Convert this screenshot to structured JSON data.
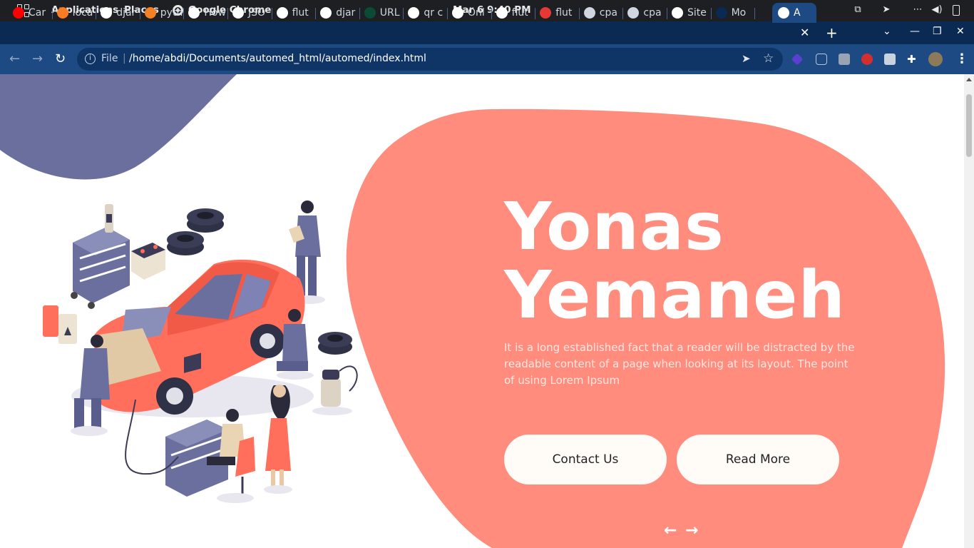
{
  "topbar": {
    "applications": "Applications",
    "places": "Places",
    "app_name": "Google Chrome",
    "clock": "Mar 6   9:40 PM"
  },
  "tabs": [
    {
      "label": "Car",
      "icon": "youtube-icon",
      "color": "#ff0000"
    },
    {
      "label": "loca",
      "icon": "xampp-icon",
      "color": "#fb7a24"
    },
    {
      "label": "djar",
      "icon": "google-icon",
      "color": "#ffffff"
    },
    {
      "label": "pyth",
      "icon": "stackoverflow-icon",
      "color": "#f48024"
    },
    {
      "label": "How",
      "icon": "globe-icon",
      "color": "#ffffff"
    },
    {
      "label": "JSO",
      "icon": "globe-icon",
      "color": "#ffffff"
    },
    {
      "label": "flut",
      "icon": "google-icon",
      "color": "#ffffff"
    },
    {
      "label": "djar",
      "icon": "google-icon",
      "color": "#ffffff"
    },
    {
      "label": "URL",
      "icon": "django-icon",
      "color": "#0c4b33"
    },
    {
      "label": "qr c",
      "icon": "google-icon",
      "color": "#ffffff"
    },
    {
      "label": "Onl",
      "icon": "qr-icon",
      "color": "#ffffff"
    },
    {
      "label": "flut",
      "icon": "google-icon",
      "color": "#ffffff"
    },
    {
      "label": "flut",
      "icon": "red-icon",
      "color": "#e53935"
    },
    {
      "label": "cpa",
      "icon": "link-icon",
      "color": "#cfd6e0"
    },
    {
      "label": "cpa",
      "icon": "link-icon",
      "color": "#cfd6e0"
    },
    {
      "label": "Site",
      "icon": "globe-icon",
      "color": "#ffffff"
    },
    {
      "label": "Mo",
      "icon": "blank-icon",
      "color": "#0b2a53"
    },
    {
      "label": "A",
      "icon": "globe-icon",
      "color": "#ffffff"
    }
  ],
  "address": {
    "scheme": "File",
    "url": "/home/abdi/Documents/automed_html/automed/index.html"
  },
  "hero": {
    "title_line1": "Yonas",
    "title_line2": "Yemaneh",
    "description": "It is a long established fact that a reader will be distracted by the readable content of a page when looking at its layout. The point of using Lorem Ipsum",
    "contact_label": "Contact Us",
    "read_more_label": "Read More",
    "prev_arrow": "←",
    "next_arrow": "→"
  },
  "colors": {
    "blob_coral": "#ff8c7c",
    "corner_navy": "#6b6f9e",
    "tab_bar": "#0b2a53",
    "toolbar": "#1d4a82"
  }
}
